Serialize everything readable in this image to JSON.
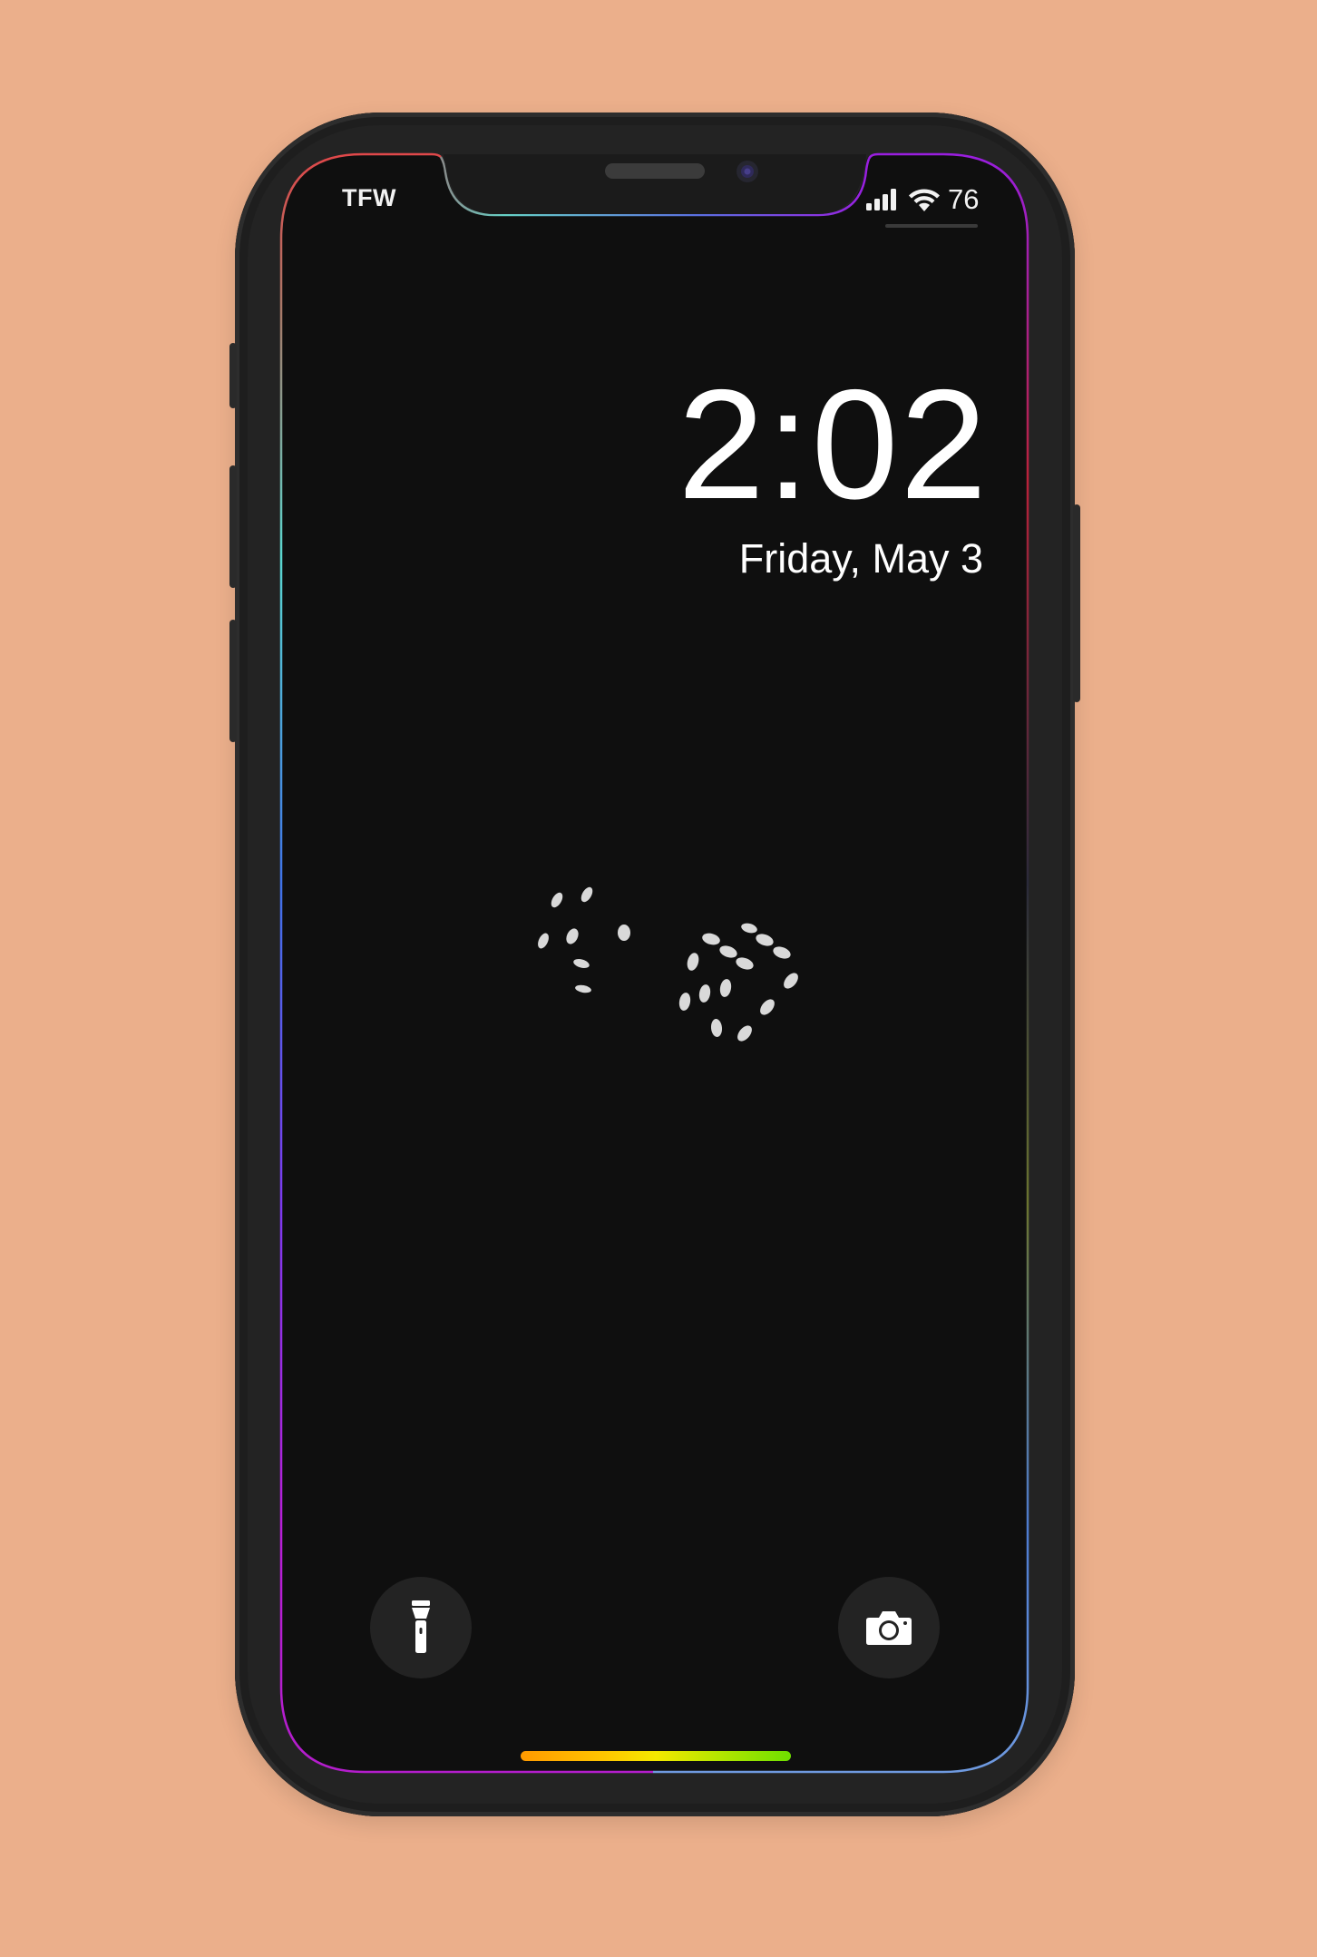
{
  "status_bar": {
    "carrier": "TFW",
    "battery": "76"
  },
  "lock_screen": {
    "time": "2:02",
    "date": "Friday, May 3"
  },
  "wallpaper": {
    "description_icon": "dice-icon"
  },
  "quick_actions": {
    "left": "flashlight-icon",
    "right": "camera-icon"
  },
  "colors": {
    "background": "#ebaf8b",
    "screen": "#0f0f0f",
    "device_frame": "#232323"
  }
}
